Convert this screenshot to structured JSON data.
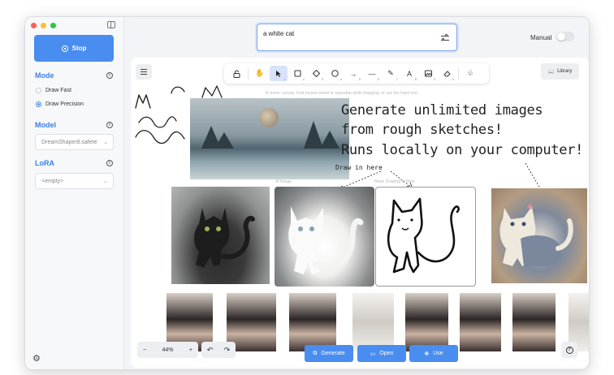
{
  "sidebar": {
    "stop_label": "Stop",
    "mode": {
      "title": "Mode",
      "options": [
        "Draw Fast",
        "Draw Precision"
      ],
      "selected": "Draw Precision"
    },
    "model": {
      "title": "Model",
      "value": "DreamShaper8.safete"
    },
    "lora": {
      "title": "LoRA",
      "value": "<empty>"
    }
  },
  "prompt": {
    "value": "a white cat"
  },
  "manual": {
    "label": "Manual",
    "on": false
  },
  "toolbar": {
    "tools": [
      "lock",
      "hand",
      "selection",
      "rectangle",
      "diamond",
      "ellipse",
      "arrow",
      "line",
      "draw",
      "text",
      "image",
      "eraser",
      "more"
    ],
    "active": "selection"
  },
  "library_label": "Library",
  "canvas_hint": "To move canvas, hold mouse wheel or spacebar while dragging, or use the hand tool",
  "annotations": {
    "headline": [
      "Generate unlimited images",
      "from rough sketches!",
      "Runs locally on your computer!"
    ],
    "draw_in_here": "Draw in here",
    "ai_image_caption": "AI Image",
    "drawing_caption": "Make Drawing In Here"
  },
  "zoom": {
    "level": "44%"
  },
  "actions": {
    "generate": "Generate",
    "open": "Open",
    "use": "Use"
  },
  "colors": {
    "accent": "#4a8df0",
    "active_tool": "#d9e2fb"
  }
}
